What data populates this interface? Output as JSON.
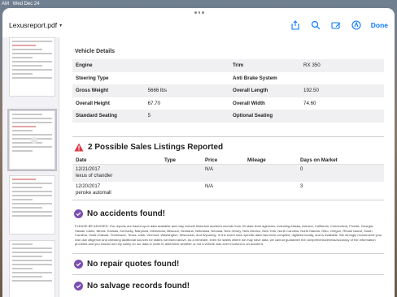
{
  "status_bar": {
    "time": "AM",
    "date": "Wed Dec 24"
  },
  "toolbar": {
    "title": "Lexusreport.pdf",
    "done_label": "Done",
    "icons": [
      "share-icon",
      "search-icon",
      "markup-icon",
      "highlight-icon",
      "done-label"
    ]
  },
  "vehicle_details": {
    "title": "Vehicle Details",
    "rows": [
      {
        "l1": "Engine",
        "v1": "",
        "l2": "Trim",
        "v2": "RX 350"
      },
      {
        "l1": "Steering Type",
        "v1": "",
        "l2": "Anti Brake System",
        "v2": ""
      },
      {
        "l1": "Gross Weight",
        "v1": "5666 lbs",
        "l2": "Overall Length",
        "v2": "192.50"
      },
      {
        "l1": "Overall Height",
        "v1": "67.70",
        "l2": "Overall Width",
        "v2": "74.60"
      },
      {
        "l1": "Standard Seating",
        "v1": "5",
        "l2": "Optional Seating",
        "v2": ""
      }
    ]
  },
  "sales": {
    "title": "2 Possible Sales Listings Reported",
    "headers": {
      "date": "Date",
      "type": "Type",
      "price": "Price",
      "mileage": "Mileage",
      "days": "Days on Market"
    },
    "rows": [
      {
        "date": "12/21/2017",
        "seller": "lexus of chandler",
        "type": "",
        "price": "N/A",
        "mileage": "",
        "days": "0"
      },
      {
        "date": "12/20/2017",
        "seller": "penske automall",
        "type": "",
        "price": "N/A",
        "mileage": "",
        "days": "3"
      }
    ]
  },
  "accidents": {
    "title": "No accidents found!",
    "disclaimer": "PLEASE BE ADVISED: Our reports are based upon data available and may include historical accident records from 33 state level agencies, including Alaska, Arizona, California, Connecticut, Florida, Georgia, Hawaii, Idaho, Illinois, Kansas, Kentucky, Maryland, Minnesota, Missouri, Montana, Nebraska, Nevada, New Jersey, New Mexico, New York, North Carolina, North Dakota, Ohio, Oregon, Rhode Island, South Carolina, South Dakota, Tennessee, Texas, Utah, Vermont, Washington, Wisconsin, and Wyoming. In the event such specific data has been compiled, digitized locally, and is available. We strongly recommend your own due diligence and checking additional sources for states not listed above. As a reminder, even for states where we may have data, we cannot guarantee the comprehensiveness/accuracy of the information provided and you should not rely solely on our data in order to determine whether or not a vehicle was ever involved in an accident."
  },
  "repairs": {
    "title": "No repair quotes found!"
  },
  "salvage": {
    "title": "No salvage records found!"
  },
  "colors": {
    "accent": "#0a7aff",
    "check": "#7b4fb0",
    "warning": "#d9363e"
  }
}
